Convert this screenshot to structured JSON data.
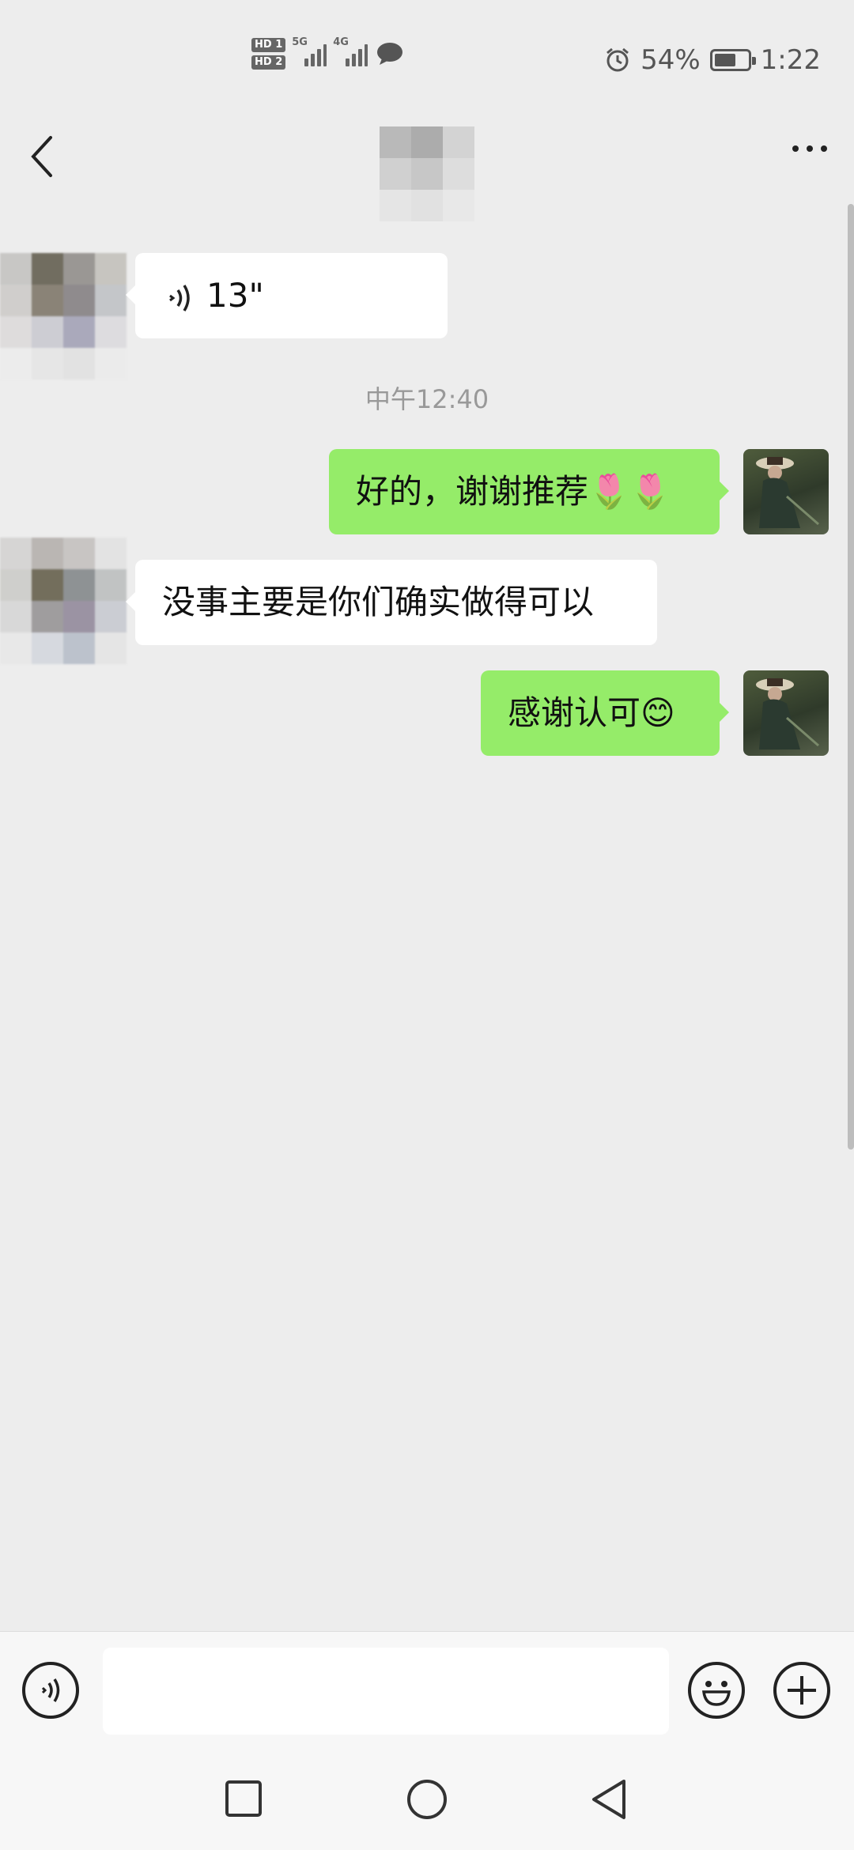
{
  "status_bar": {
    "sim1": "HD 1",
    "sim2": "HD 2",
    "net1": "5G",
    "net2": "4G",
    "battery_percent": "54%",
    "time": "1:22",
    "battery_level": 0.54
  },
  "header": {
    "back_icon": "chevron-left-icon",
    "more_icon": "more-dots-icon"
  },
  "messages": {
    "voice": {
      "duration": "13\""
    },
    "timestamp": "中午12:40",
    "m1": "好的，谢谢推荐🌷🌷",
    "m2": "没事主要是你们确实做得可以",
    "m3": "感谢认可😊"
  },
  "input_bar": {
    "voice_icon": "voice-icon",
    "emoji_icon": "emoji-icon",
    "plus_icon": "plus-icon",
    "text_value": ""
  },
  "system_nav": {
    "recent_icon": "square-icon",
    "home_icon": "circle-icon",
    "back_icon": "triangle-back-icon"
  }
}
